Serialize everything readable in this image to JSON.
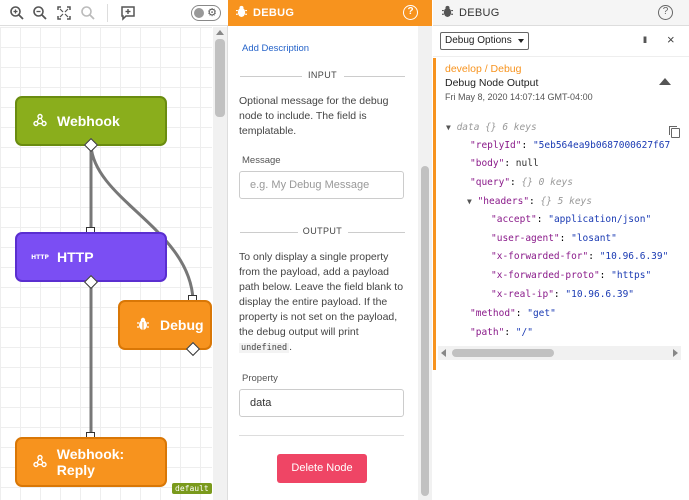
{
  "canvas": {
    "toolbar_icons": [
      "zoom-in-icon",
      "zoom-out-icon",
      "fit-screen-icon",
      "search-icon",
      "add-comment-icon"
    ],
    "toggle_icon": "gear-icon",
    "nodes": {
      "webhook": "Webhook",
      "http": "HTTP",
      "http_badge": "HTTP",
      "debug": "Debug",
      "reply": "Webhook: Reply"
    },
    "default_badge": "default"
  },
  "editor": {
    "title": "DEBUG",
    "help": "?",
    "add_description": "Add Description",
    "input_section": "INPUT",
    "input_help": "Optional message for the debug node to include. The field is templatable.",
    "message_label": "Message",
    "message_placeholder": "e.g. My Debug Message",
    "output_section": "OUTPUT",
    "output_help_before": "To only display a single property from the payload, add a payload path below. Leave the field blank to display the entire payload. If the property is not set on the payload, the debug output will print ",
    "output_help_code": "undefined",
    "output_help_after": ".",
    "property_label": "Property",
    "property_value": "data",
    "delete_button": "Delete Node"
  },
  "debug_panel": {
    "title": "DEBUG",
    "help": "?",
    "options_label": "Debug Options",
    "pause": "II",
    "close": "×",
    "message": {
      "path": "develop / Debug",
      "name": "Debug Node Output",
      "time": "Fri May 8, 2020 14:07:14 GMT-04:00"
    },
    "json": {
      "root_key": "data",
      "root_meta": "{} 6 keys",
      "replyId_key": "\"replyId\"",
      "replyId_val": "\"5eb564ea9b0687000627f67",
      "body_key": "\"body\"",
      "body_val": "null",
      "query_key": "\"query\"",
      "query_meta": "{} 0 keys",
      "headers_key": "\"headers\"",
      "headers_meta": "{} 5 keys",
      "accept_key": "\"accept\"",
      "accept_val": "\"application/json\"",
      "ua_key": "\"user-agent\"",
      "ua_val": "\"losant\"",
      "xff_key": "\"x-forwarded-for\"",
      "xff_val": "\"10.96.6.39\"",
      "xfp_key": "\"x-forwarded-proto\"",
      "xfp_val": "\"https\"",
      "xri_key": "\"x-real-ip\"",
      "xri_val": "\"10.96.6.39\"",
      "method_key": "\"method\"",
      "method_val": "\"get\"",
      "path_key": "\"path\"",
      "path_val": "\"/\""
    }
  }
}
